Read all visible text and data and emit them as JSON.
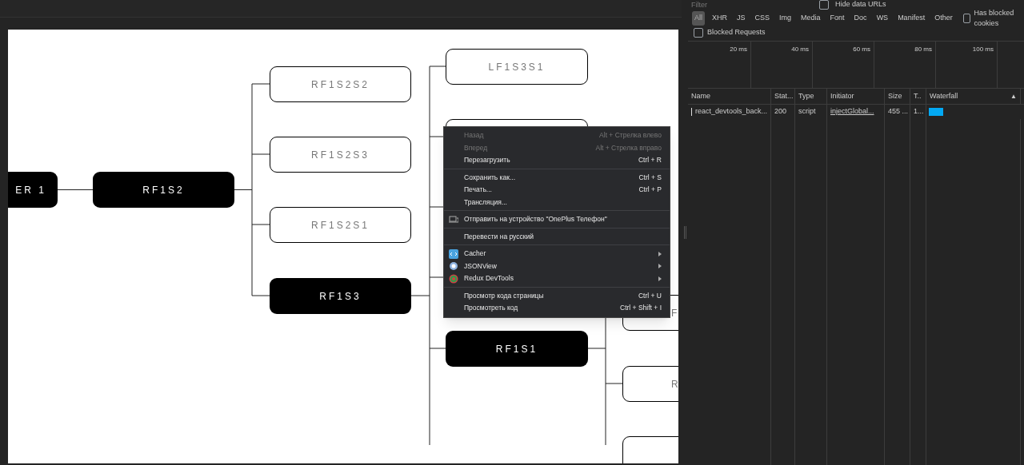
{
  "diagram": {
    "nodes": [
      {
        "label": "ER 1",
        "kind": "dark"
      },
      {
        "label": "RF1S2",
        "kind": "dark"
      },
      {
        "label": "RF1S2S2",
        "kind": "light"
      },
      {
        "label": "RF1S2S3",
        "kind": "light"
      },
      {
        "label": "RF1S2S1",
        "kind": "light"
      },
      {
        "label": "RF1S3",
        "kind": "dark"
      },
      {
        "label": "LF1S3S1",
        "kind": "light"
      },
      {
        "kind": "light"
      },
      {
        "label": "RF1S1",
        "kind": "dark"
      },
      {
        "label": "F",
        "kind": "light"
      },
      {
        "label": "R",
        "kind": "light"
      },
      {
        "kind": "light"
      }
    ]
  },
  "context_menu": {
    "groups": [
      [
        {
          "label": "Назад",
          "shortcut": "Alt + Стрелка влево",
          "disabled": true
        },
        {
          "label": "Вперед",
          "shortcut": "Alt + Стрелка вправо",
          "disabled": true
        },
        {
          "label": "Перезагрузить",
          "shortcut": "Ctrl + R",
          "disabled": false
        }
      ],
      [
        {
          "label": "Сохранить как...",
          "shortcut": "Ctrl + S",
          "disabled": false
        },
        {
          "label": "Печать...",
          "shortcut": "Ctrl + P",
          "disabled": false
        },
        {
          "label": "Трансляция...",
          "disabled": false
        }
      ],
      [
        {
          "label": "Отправить на устройство \"OnePlus Телефон\"",
          "kind": "device",
          "disabled": false
        }
      ],
      [
        {
          "label": "Перевести на русский",
          "disabled": false
        }
      ],
      [
        {
          "label": "Cacher",
          "kind": "code",
          "submenu": true,
          "disabled": false
        },
        {
          "label": "JSONView",
          "kind": "ring",
          "submenu": true,
          "disabled": false
        },
        {
          "label": "Redux DevTools",
          "kind": "target",
          "submenu": true,
          "disabled": false
        }
      ],
      [
        {
          "label": "Просмотр кода страницы",
          "shortcut": "Ctrl + U",
          "disabled": false
        },
        {
          "label": "Просмотреть код",
          "shortcut": "Ctrl + Shift + I",
          "disabled": false
        }
      ]
    ]
  },
  "devtools": {
    "filter": {
      "placeholder": "Filter"
    },
    "hide_data_urls": {
      "label": "Hide data URLs",
      "checked": false
    },
    "type_filters": [
      {
        "label": "All",
        "selected": true
      },
      {
        "label": "XHR",
        "selected": false
      },
      {
        "label": "JS",
        "selected": false
      },
      {
        "label": "CSS",
        "selected": false
      },
      {
        "label": "Img",
        "selected": false
      },
      {
        "label": "Media",
        "selected": false
      },
      {
        "label": "Font",
        "selected": false
      },
      {
        "label": "Doc",
        "selected": false
      },
      {
        "label": "WS",
        "selected": false
      },
      {
        "label": "Manifest",
        "selected": false
      },
      {
        "label": "Other",
        "selected": false
      }
    ],
    "has_blocked_cookies": {
      "label": "Has blocked cookies",
      "checked": false
    },
    "blocked_requests": {
      "label": "Blocked Requests",
      "checked": false
    },
    "timeline_ticks": [
      "20 ms",
      "40 ms",
      "60 ms",
      "80 ms",
      "100 ms"
    ],
    "table": {
      "columns": [
        "Name",
        "Stat...",
        "Type",
        "Initiator",
        "Size",
        "T..",
        "Waterfall"
      ],
      "sort_mark": "▲",
      "rows": [
        {
          "name": "react_devtools_back...",
          "status": "200",
          "type": "script",
          "initiator": "injectGlobal...",
          "size": "455 ...",
          "time": "1..."
        }
      ]
    }
  }
}
